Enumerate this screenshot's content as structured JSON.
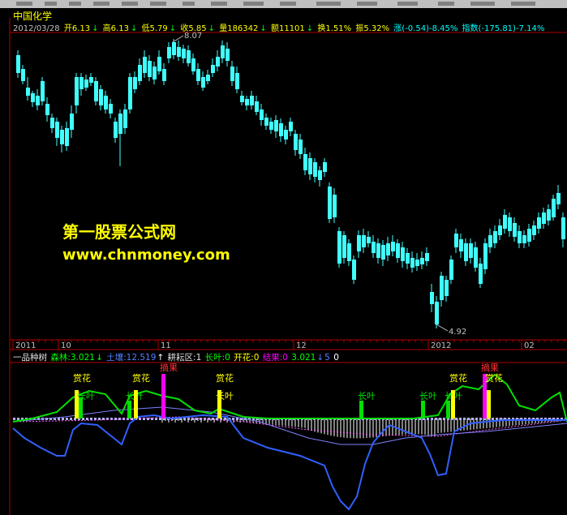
{
  "stock_name": "中国化学",
  "quote": {
    "date": "2012/03/28",
    "open": "开6.13",
    "high": "高6.13",
    "low": "低5.79",
    "close": "收5.85",
    "volume": "量186342",
    "amount": "额11101",
    "turnover": "换1.51%",
    "amplitude": "振5.32%",
    "change": "涨(-0.54)-8.45%",
    "index": "指数(-175.81)-7.14%",
    "arrow": "↓"
  },
  "axis_labels": {
    "y2011": "2011",
    "m10": "10",
    "m11": "11",
    "m12": "12",
    "y2012": "2012",
    "m02": "02"
  },
  "price_marks": {
    "high_label": "8.07",
    "low_label": "4.92"
  },
  "indicator": {
    "name": "一品种树",
    "senlin": "森林:3.021",
    "tuxiang": "土壤:12.519",
    "gengzhi": "耕耘区:1",
    "zhangye": "长叶:0",
    "kaihua": "开花:0",
    "jieguo": "结果:0",
    "val1": "3.021",
    "val2": "5",
    "val3": "0"
  },
  "signals": {
    "shanghua": "赏花",
    "zhangye": "长叶",
    "zhaiguo": "摘果"
  },
  "watermark": {
    "line1": "第一股票公式网",
    "line2": "www.chnmoney.com"
  },
  "colors": {
    "up": "#ff4040",
    "down": "#40ffff",
    "axis": "#b00000",
    "green": "#00e000",
    "blue": "#3060ff",
    "magenta": "#ff00ff",
    "yellow": "#ffff00"
  }
}
